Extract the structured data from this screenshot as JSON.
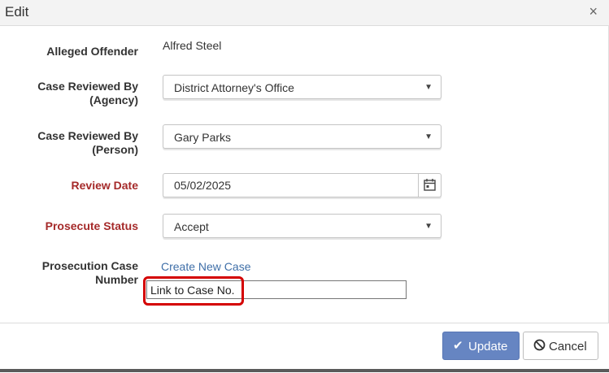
{
  "dialog": {
    "title": "Edit",
    "close_symbol": "×"
  },
  "fields": {
    "alleged_offender": {
      "label": "Alleged Offender",
      "value": "Alfred Steel"
    },
    "reviewed_by_agency": {
      "label_line1": "Case Reviewed By",
      "label_line2": "(Agency)",
      "value": "District Attorney's Office"
    },
    "reviewed_by_person": {
      "label_line1": "Case Reviewed By",
      "label_line2": "(Person)",
      "value": "Gary Parks"
    },
    "review_date": {
      "label": "Review Date",
      "value": "05/02/2025"
    },
    "prosecute_status": {
      "label": "Prosecute Status",
      "value": "Accept"
    },
    "prosecution_case_number": {
      "label_line1": "Prosecution Case",
      "label_line2": "Number",
      "link": "Create New Case",
      "input_value": "Link to Case No."
    }
  },
  "colors": {
    "required_label": "#a52a2a",
    "link": "#3f6fa8",
    "primary_button": "#6685c2",
    "highlight": "#d40000"
  },
  "buttons": {
    "update": "Update",
    "cancel": "Cancel"
  }
}
